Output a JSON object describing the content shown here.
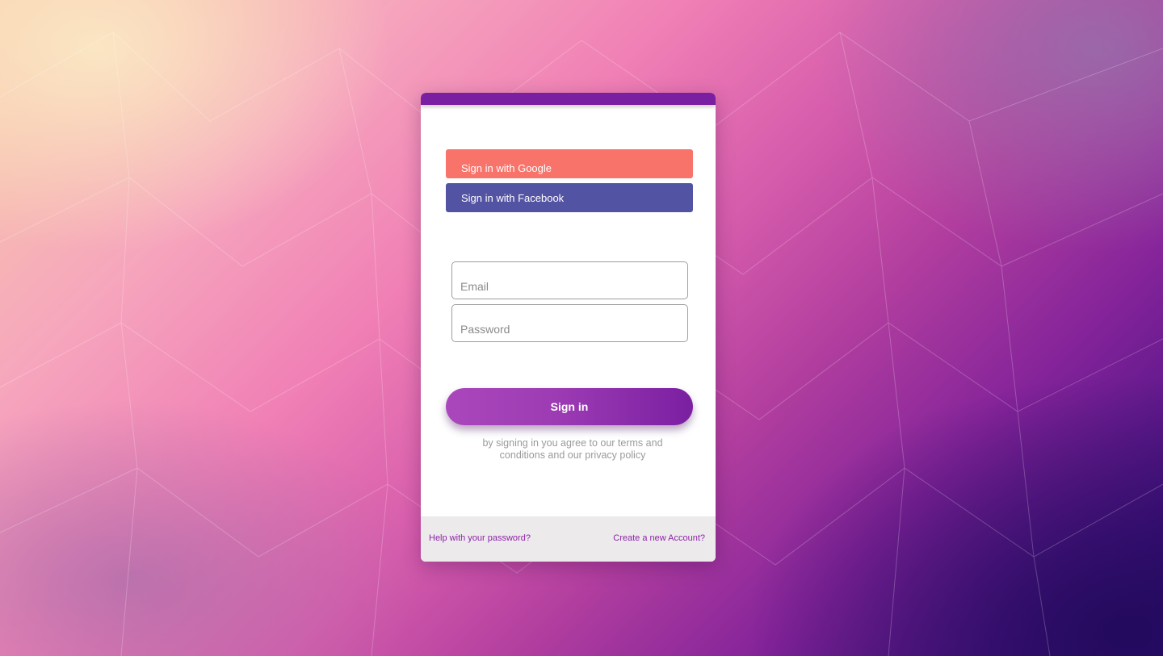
{
  "auth": {
    "google_label": "Sign in with Google",
    "facebook_label": "Sign in with Facebook",
    "email_placeholder": "Email",
    "email_value": "",
    "password_placeholder": "Password",
    "password_value": "",
    "signin_label": "Sign in",
    "terms_text": "by signing in you agree to our terms and conditions and our privacy policy"
  },
  "footer": {
    "help_link": "Help with your password?",
    "create_link": "Create a new Account?"
  },
  "colors": {
    "accent": "#7b1fa2",
    "google": "#f8736a",
    "facebook": "#5353a3",
    "link": "#8e24aa",
    "footer_bg": "#eceaea"
  }
}
